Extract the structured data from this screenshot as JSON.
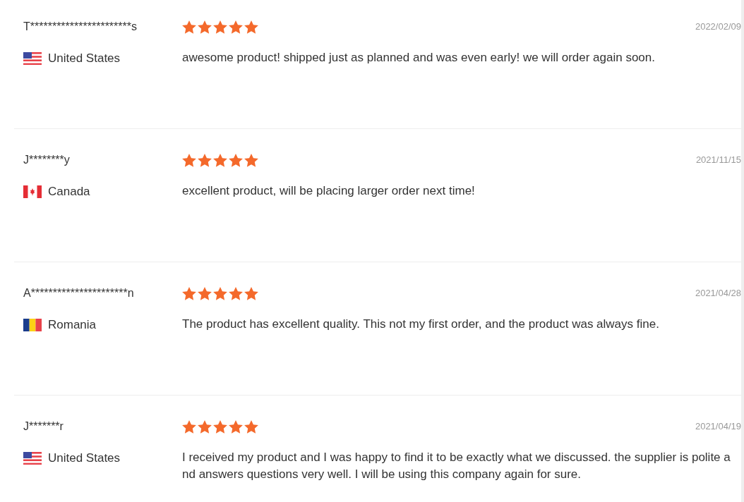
{
  "reviews": [
    {
      "reviewer": "T***********************s",
      "kind": "us",
      "country": "United States",
      "stars": 5,
      "date": "2022/02/09",
      "text": "awesome product! shipped just as planned and was even early! we will order again soon."
    },
    {
      "reviewer": "J********y",
      "kind": "ca",
      "country": "Canada",
      "stars": 5,
      "date": "2021/11/15",
      "text": "excellent product, will be placing larger order next time!"
    },
    {
      "reviewer": "A**********************n",
      "kind": "ro",
      "country": "Romania",
      "stars": 5,
      "date": "2021/04/28",
      "text": "The product has excellent quality. This not my first order, and the product was always fine."
    },
    {
      "reviewer": "J*******r",
      "kind": "us",
      "country": "United States",
      "stars": 5,
      "date": "2021/04/19",
      "text": "I received my product and I was happy to find it to be exactly what we discussed. the supplier is polite and answers questions very well. I will be using this company again for sure."
    }
  ]
}
